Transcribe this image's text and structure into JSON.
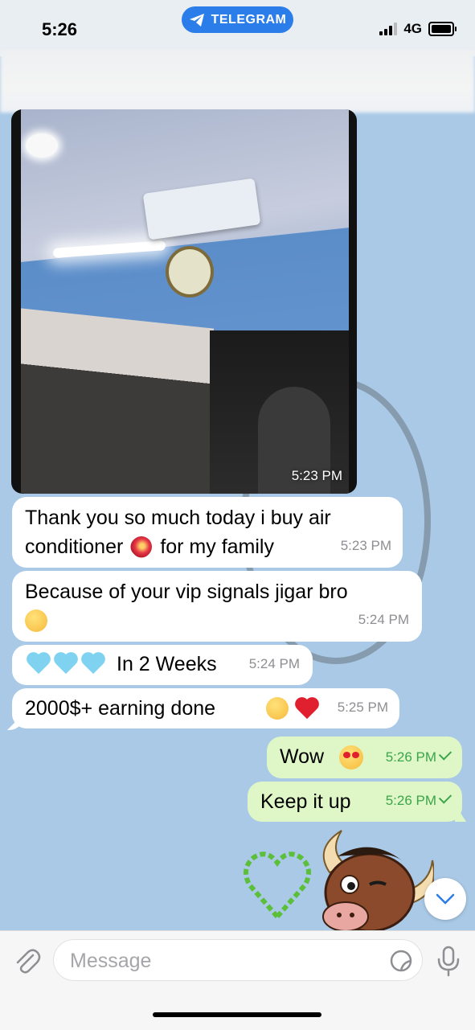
{
  "status_bar": {
    "time": "5:26",
    "app_pill": "TELEGRAM",
    "network": "4G"
  },
  "messages": [
    {
      "type": "photo",
      "direction": "in",
      "time": "5:23 PM"
    },
    {
      "type": "text",
      "direction": "in",
      "text_line1": "Thank you so much today i buy air",
      "text_line2a": "conditioner",
      "text_line2b": "for my family",
      "time": "5:23 PM"
    },
    {
      "type": "text",
      "direction": "in",
      "text": "Because of your vip signals jigar bro",
      "time": "5:24 PM"
    },
    {
      "type": "text",
      "direction": "in",
      "text": "In 2 Weeks",
      "time": "5:24 PM"
    },
    {
      "type": "text",
      "direction": "in",
      "text": "2000$+ earning done",
      "time": "5:25 PM"
    },
    {
      "type": "text",
      "direction": "out",
      "text": "Wow",
      "time": "5:26 PM"
    },
    {
      "type": "text",
      "direction": "out",
      "text": "Keep it up",
      "time": "5:26 PM"
    }
  ],
  "composer": {
    "placeholder": "Message"
  },
  "icons": [
    "telegram-send-icon",
    "signal-icon",
    "battery-icon",
    "attach-icon",
    "sticker-icon",
    "mic-icon",
    "chevron-down-icon"
  ],
  "colors": {
    "chat_background": "#a9c9e6",
    "incoming_bubble": "#ffffff",
    "outgoing_bubble": "#dff7c6",
    "outgoing_meta": "#3aa54a",
    "accent": "#2b7de9"
  }
}
